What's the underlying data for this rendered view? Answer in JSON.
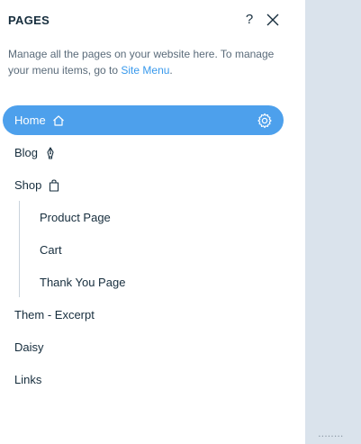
{
  "panel": {
    "title": "PAGES",
    "help_label": "?",
    "description_prefix": "Manage all the pages on your website here. To manage your menu items, go to ",
    "description_link": "Site Menu",
    "description_suffix": "."
  },
  "pages": [
    {
      "label": "Home",
      "icon": "home-icon",
      "selected": true
    },
    {
      "label": "Blog",
      "icon": "pen-icon"
    },
    {
      "label": "Shop",
      "icon": "shopping-bag-icon"
    },
    {
      "label": "Product Page",
      "sub": true
    },
    {
      "label": "Cart",
      "sub": true
    },
    {
      "label": "Thank You Page",
      "sub": true
    },
    {
      "label": "Them - Excerpt"
    },
    {
      "label": "Daisy"
    },
    {
      "label": "Links"
    }
  ],
  "canvas": {
    "footer_text": "• • • • • • • •"
  },
  "colors": {
    "accent": "#4da0ec",
    "link": "#3899ec",
    "text": "#162d3d",
    "canvas_bg": "#dae3ec"
  }
}
